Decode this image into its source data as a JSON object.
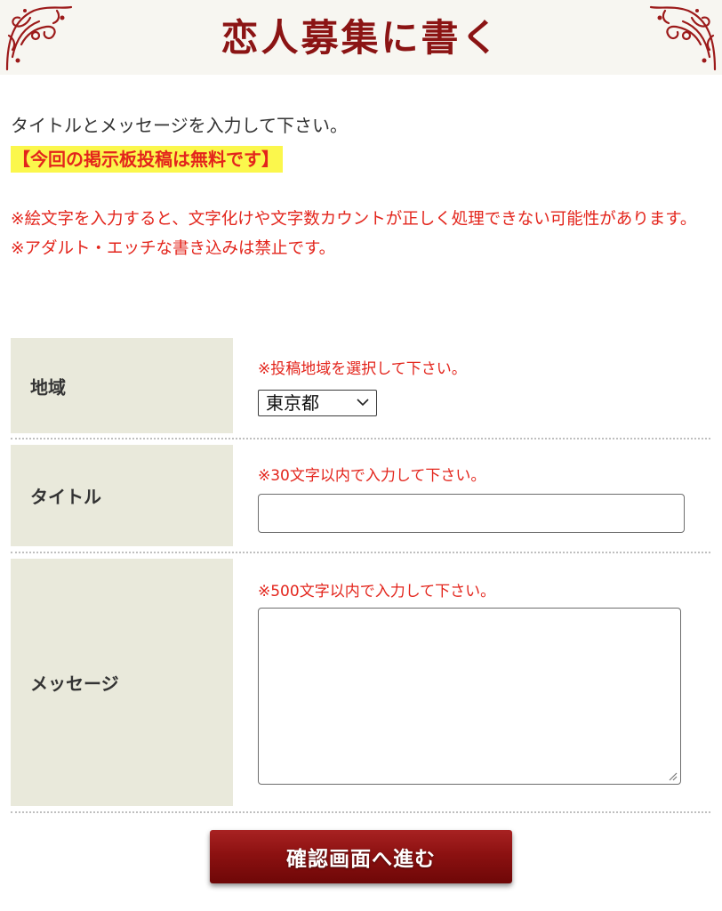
{
  "header": {
    "title": "恋人募集に書く"
  },
  "intro": {
    "text": "タイトルとメッセージを入力して下さい。",
    "free_notice": "【今回の掲示板投稿は無料です】"
  },
  "warnings": [
    "※絵文字を入力すると、文字化けや文字数カウントが正しく処理できない可能性があります。",
    "※アダルト・エッチな書き込みは禁止です。"
  ],
  "form": {
    "region": {
      "label": "地域",
      "hint": "※投稿地域を選択して下さい。",
      "selected": "東京都"
    },
    "title": {
      "label": "タイトル",
      "hint": "※30文字以内で入力して下さい。",
      "value": ""
    },
    "message": {
      "label": "メッセージ",
      "hint": "※500文字以内で入力して下さい。",
      "value": ""
    },
    "submit_label": "確認画面へ進む"
  },
  "colors": {
    "title": "#8b1414",
    "warning": "#e3251c",
    "highlight": "#fbf74c",
    "label_bg": "#e9e9db",
    "button": "#8c1111"
  },
  "icons": {
    "ornament": "corner-ornament-icon",
    "select": "chevron-down-icon",
    "resize": "resize-grip-icon"
  }
}
